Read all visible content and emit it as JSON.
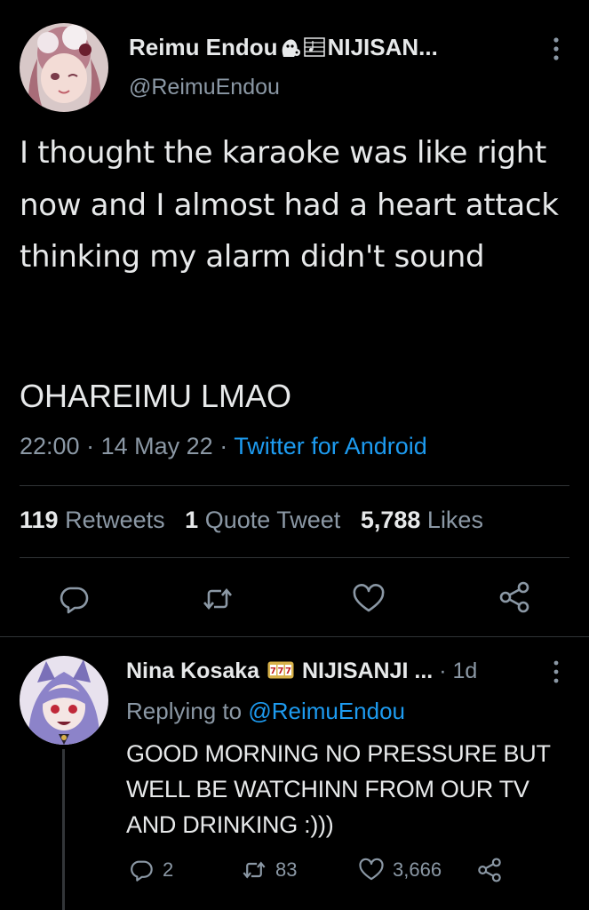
{
  "main_tweet": {
    "display_name": "Reimu Endou",
    "name_suffix": "NIJISAN...",
    "handle": "@ReimuEndou",
    "text": "I thought the karaoke was like right now and I almost had a heart attack thinking my alarm didn't sound",
    "text2": "OHAREIMU LMAO",
    "time": "22:00",
    "date": "14 May 22",
    "source": "Twitter for Android",
    "stats": {
      "retweets_count": "119",
      "retweets_label": "Retweets",
      "quotes_count": "1",
      "quotes_label": "Quote Tweet",
      "likes_count": "5,788",
      "likes_label": "Likes"
    }
  },
  "reply_tweet": {
    "display_name": "Nina Kosaka",
    "name_suffix": "NIJISANJI ...",
    "time": "1d",
    "replying_prefix": "Replying to",
    "replying_to": "@ReimuEndou",
    "text": "GOOD MORNING NO PRESSURE BUT WELL BE WATCHINN FROM OUR TV AND DRINKING :)))",
    "replies": "2",
    "retweets": "83",
    "likes": "3,666"
  },
  "icons": {
    "reply": "speech-bubble-icon",
    "retweet": "retweet-icon",
    "like": "heart-icon",
    "share": "share-icon",
    "more": "vertical-dots-icon"
  },
  "colors": {
    "background": "#000000",
    "text": "#e7e9ea",
    "muted": "#8b98a5",
    "accent": "#1d9bf0"
  }
}
